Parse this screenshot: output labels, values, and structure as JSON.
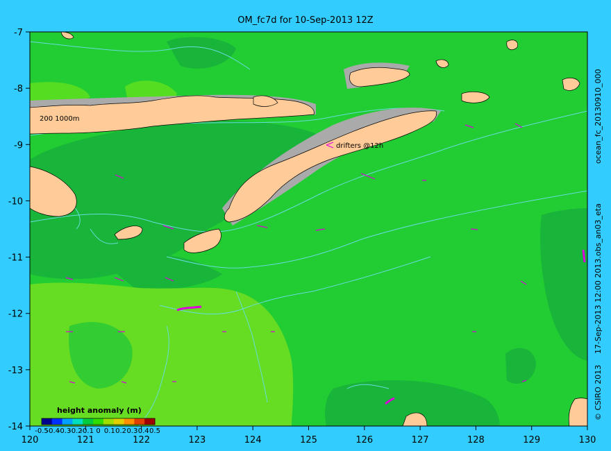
{
  "title": "OM_fc7d for 10-Sep-2013 12Z",
  "map": {
    "x_ticks": [
      "120",
      "121",
      "122",
      "123",
      "124",
      "125",
      "126",
      "127",
      "128",
      "129",
      "130"
    ],
    "y_ticks": [
      "-7",
      "-8",
      "-9",
      "-10",
      "-11",
      "-12",
      "-13",
      "-14"
    ],
    "contour_label": "200  1000m",
    "drifters_label": "drifters @12h"
  },
  "legend": {
    "title": "height anomaly (m)",
    "ticks": [
      "-0.5",
      "-0.4",
      "-0.3",
      "-0.2",
      "-0.1",
      "0",
      "0.1",
      "0.2",
      "0.3",
      "0.4",
      "0.5"
    ],
    "colors": [
      "#00008f",
      "#0030ff",
      "#00a0ff",
      "#00e0c0",
      "#00cc40",
      "#30dd00",
      "#a0e000",
      "#e0d000",
      "#ff9000",
      "#e04000",
      "#a00000"
    ]
  },
  "side_labels": {
    "run": "ocean_fc_20130910_000",
    "product": "17-Sep-2013 12:00  2013.obs_an03_eta",
    "copyright": "© CSIRO 2013"
  },
  "colors": {
    "background": "#33ccff",
    "land": "#ffcc99",
    "shelf": "#aaaaaa",
    "contour": "#66dddd",
    "drifter": "#dd00dd"
  }
}
